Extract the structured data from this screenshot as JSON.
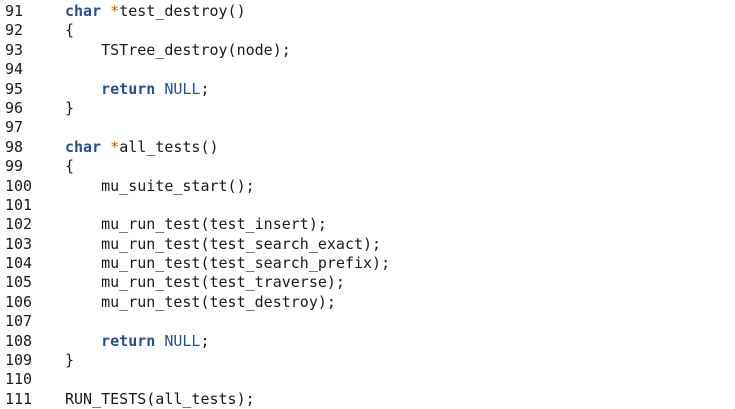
{
  "editor": {
    "colors": {
      "keyword": "#2b4f8a",
      "pointer": "#c06000",
      "text": "#1a1a1a",
      "background": "#ffffff"
    },
    "lines": [
      {
        "number": "91",
        "tokens": [
          {
            "t": "kw",
            "text": "char"
          },
          {
            "t": "plain",
            "text": " "
          },
          {
            "t": "ptr",
            "text": "*"
          },
          {
            "t": "plain",
            "text": "test_destroy()"
          }
        ]
      },
      {
        "number": "92",
        "tokens": [
          {
            "t": "plain",
            "text": "{"
          }
        ]
      },
      {
        "number": "93",
        "tokens": [
          {
            "t": "plain",
            "text": "    TSTree_destroy(node);"
          }
        ]
      },
      {
        "number": "94",
        "tokens": []
      },
      {
        "number": "95",
        "tokens": [
          {
            "t": "plain",
            "text": "    "
          },
          {
            "t": "kw",
            "text": "return"
          },
          {
            "t": "plain",
            "text": " "
          },
          {
            "t": "const",
            "text": "NULL"
          },
          {
            "t": "plain",
            "text": ";"
          }
        ]
      },
      {
        "number": "96",
        "tokens": [
          {
            "t": "plain",
            "text": "}"
          }
        ]
      },
      {
        "number": "97",
        "tokens": []
      },
      {
        "number": "98",
        "tokens": [
          {
            "t": "kw",
            "text": "char"
          },
          {
            "t": "plain",
            "text": " "
          },
          {
            "t": "ptr",
            "text": "*"
          },
          {
            "t": "plain",
            "text": "all_tests()"
          }
        ]
      },
      {
        "number": "99",
        "tokens": [
          {
            "t": "plain",
            "text": "{"
          }
        ]
      },
      {
        "number": "100",
        "tokens": [
          {
            "t": "plain",
            "text": "    mu_suite_start();"
          }
        ]
      },
      {
        "number": "101",
        "tokens": []
      },
      {
        "number": "102",
        "tokens": [
          {
            "t": "plain",
            "text": "    mu_run_test(test_insert);"
          }
        ]
      },
      {
        "number": "103",
        "tokens": [
          {
            "t": "plain",
            "text": "    mu_run_test(test_search_exact);"
          }
        ]
      },
      {
        "number": "104",
        "tokens": [
          {
            "t": "plain",
            "text": "    mu_run_test(test_search_prefix);"
          }
        ]
      },
      {
        "number": "105",
        "tokens": [
          {
            "t": "plain",
            "text": "    mu_run_test(test_traverse);"
          }
        ]
      },
      {
        "number": "106",
        "tokens": [
          {
            "t": "plain",
            "text": "    mu_run_test(test_destroy);"
          }
        ]
      },
      {
        "number": "107",
        "tokens": []
      },
      {
        "number": "108",
        "tokens": [
          {
            "t": "plain",
            "text": "    "
          },
          {
            "t": "kw",
            "text": "return"
          },
          {
            "t": "plain",
            "text": " "
          },
          {
            "t": "const",
            "text": "NULL"
          },
          {
            "t": "plain",
            "text": ";"
          }
        ]
      },
      {
        "number": "109",
        "tokens": [
          {
            "t": "plain",
            "text": "}"
          }
        ]
      },
      {
        "number": "110",
        "tokens": []
      },
      {
        "number": "111",
        "tokens": [
          {
            "t": "plain",
            "text": "RUN_TESTS(all_tests);"
          }
        ]
      }
    ]
  }
}
